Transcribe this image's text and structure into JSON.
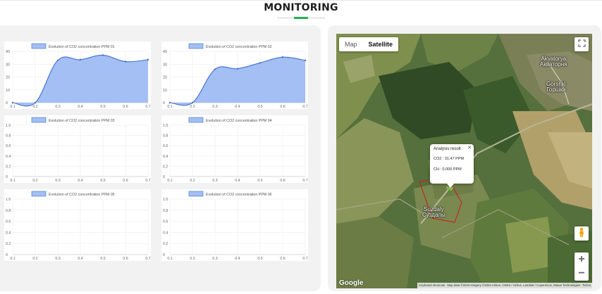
{
  "page": {
    "title": "MONITORING"
  },
  "charts": [
    {
      "title": "Evolution of CO2 concentration PPM 01",
      "chart_data": {
        "type": "area",
        "title": "Evolution of CO2 concentration PPM 01",
        "x": [
          0.1,
          0.2,
          0.3,
          0.4,
          0.5,
          0.6,
          0.7
        ],
        "values": [
          0,
          0,
          33,
          33.5,
          37,
          32,
          33.5
        ],
        "xticks": [
          "0.1",
          "0.2",
          "0.3",
          "0.4",
          "0.5",
          "0.6",
          "0.7"
        ],
        "yticks": [
          "0",
          "10",
          "20",
          "30",
          "40"
        ],
        "ylim": [
          0,
          40
        ]
      }
    },
    {
      "title": "Evolution of CO2 concentration PPM 02",
      "chart_data": {
        "type": "area",
        "title": "Evolution of CO2 concentration PPM 02",
        "x": [
          0.1,
          0.2,
          0.3,
          0.4,
          0.5,
          0.6,
          0.7
        ],
        "values": [
          0,
          0,
          26,
          26.5,
          31,
          35.5,
          33
        ],
        "xticks": [
          "0.1",
          "0.2",
          "0.3",
          "0.4",
          "0.5",
          "0.6",
          "0.7"
        ],
        "yticks": [
          "0",
          "10",
          "20",
          "30",
          "40"
        ],
        "ylim": [
          0,
          40
        ]
      }
    },
    {
      "title": "Evolution of CO2 concentration PPM 03",
      "chart_data": {
        "type": "area",
        "title": "Evolution of CO2 concentration PPM 03",
        "x": [],
        "values": [],
        "xticks": [
          "0.1",
          "0.2",
          "0.3",
          "0.4",
          "0.5",
          "0.6",
          "0.7"
        ],
        "yticks": [
          "0",
          "0.2",
          "0.4",
          "0.6",
          "0.8",
          "1.0"
        ],
        "ylim": [
          0,
          1
        ]
      }
    },
    {
      "title": "Evolution of CO2 concentration PPM 04",
      "chart_data": {
        "type": "area",
        "title": "Evolution of CO2 concentration PPM 04",
        "x": [],
        "values": [],
        "xticks": [
          "0.1",
          "0.2",
          "0.3",
          "0.4",
          "0.5",
          "0.6",
          "0.7"
        ],
        "yticks": [
          "0",
          "0.2",
          "0.4",
          "0.6",
          "0.8",
          "1.0"
        ],
        "ylim": [
          0,
          1
        ]
      }
    },
    {
      "title": "Evolution of CO2 concentration PPM 05",
      "chart_data": {
        "type": "area",
        "title": "Evolution of CO2 concentration PPM 05",
        "x": [],
        "values": [],
        "xticks": [
          "0.1",
          "0.2",
          "0.3",
          "0.4",
          "0.5",
          "0.6",
          "0.7"
        ],
        "yticks": [
          "0",
          "0.2",
          "0.4",
          "0.6",
          "0.8",
          "1.0"
        ],
        "ylim": [
          0,
          1
        ]
      }
    },
    {
      "title": "Evolution of CO2 concentration PPM 06",
      "chart_data": {
        "type": "area",
        "title": "Evolution of CO2 concentration PPM 06",
        "x": [],
        "values": [],
        "xticks": [
          "0.1",
          "0.2",
          "0.3",
          "0.4",
          "0.5",
          "0.6",
          "0.7"
        ],
        "yticks": [
          "0",
          "0.2",
          "0.4",
          "0.6",
          "0.8",
          "1.0"
        ],
        "ylim": [
          0,
          1
        ]
      }
    }
  ],
  "colors": {
    "series_fill": "#a3bff3",
    "series_stroke": "#3f6fcf",
    "grid": "#e8e8e8",
    "accent": "#22b14c"
  },
  "map": {
    "type_buttons": [
      "Map",
      "Satellite"
    ],
    "active_type": "Satellite",
    "labels": {
      "akvatorya": "Akvatorya",
      "akvatorya_ru": "Акваторня",
      "gorshki": "Gorshki",
      "gorshki_ru": "Горшки",
      "suzdaly": "Suzdaly",
      "suzdaly_ru": "Суздалы"
    },
    "info_window": {
      "title": "Analysis result :",
      "co2": "CO2 : 31.47 PPM",
      "ch": "CH : 0.000 PPM"
    },
    "zoom_in": "+",
    "zoom_out": "−",
    "google": "Google",
    "attribution": [
      "Keyboard shortcuts",
      "Map data ©2023 Imagery ©2023 Airbus, CNES / Airbus, Landsat / Copernicus, Maxar Technologies",
      "Terms"
    ],
    "icons": [
      "fullscreen-icon",
      "pegman-icon",
      "plant-marker-icon"
    ]
  }
}
